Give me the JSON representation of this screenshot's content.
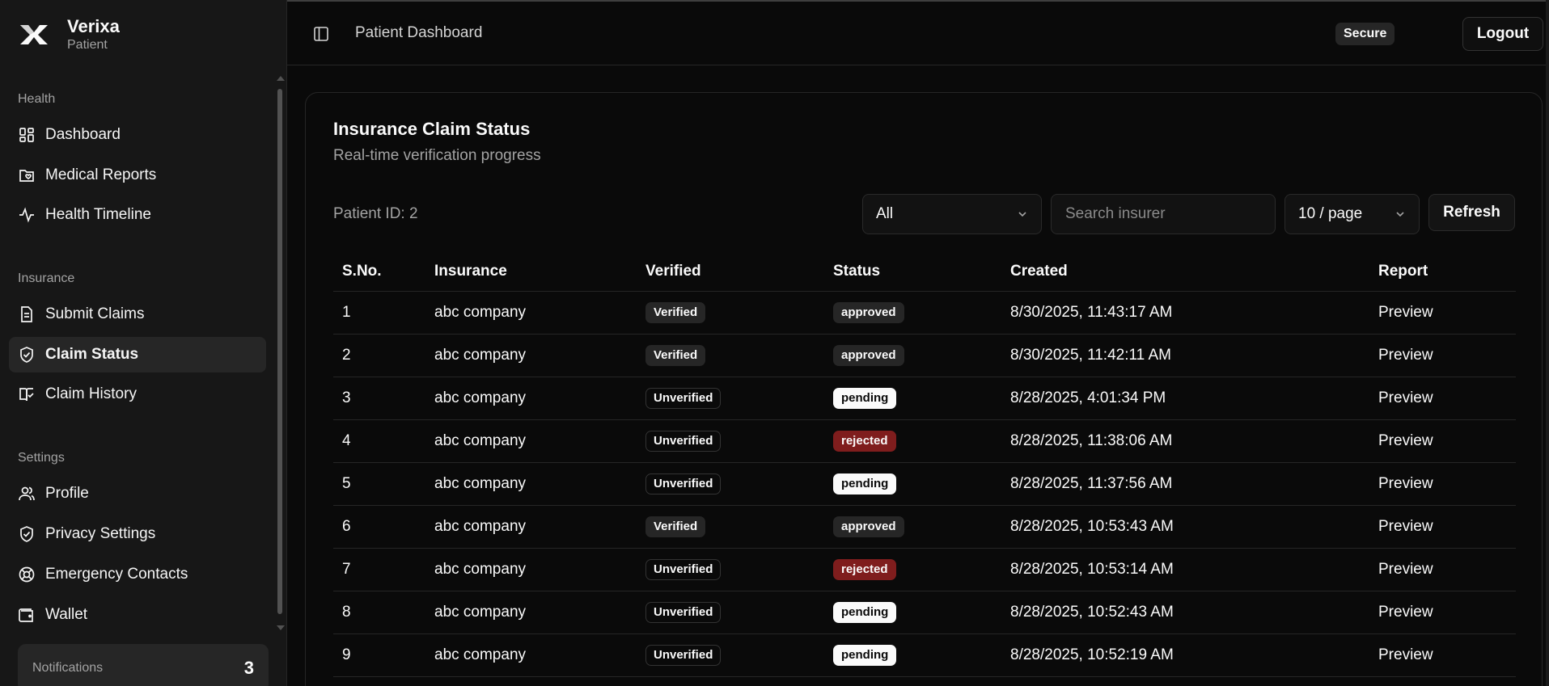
{
  "brand": {
    "name": "Verixa",
    "role": "Patient",
    "icon": "verixa-logo-icon"
  },
  "sidebar": {
    "sections": [
      {
        "label": "Health",
        "items": [
          {
            "label": "Dashboard",
            "icon": "dashboard-icon"
          },
          {
            "label": "Medical Reports",
            "icon": "folder-heart-icon"
          },
          {
            "label": "Health Timeline",
            "icon": "activity-icon"
          }
        ]
      },
      {
        "label": "Insurance",
        "items": [
          {
            "label": "Submit Claims",
            "icon": "file-text-icon"
          },
          {
            "label": "Claim Status",
            "icon": "shield-check-icon",
            "active": true
          },
          {
            "label": "Claim History",
            "icon": "book-check-icon"
          }
        ]
      },
      {
        "label": "Settings",
        "items": [
          {
            "label": "Profile",
            "icon": "users-icon"
          },
          {
            "label": "Privacy Settings",
            "icon": "shield-icon"
          },
          {
            "label": "Emergency Contacts",
            "icon": "life-buoy-icon"
          },
          {
            "label": "Wallet",
            "icon": "wallet-icon"
          }
        ]
      }
    ],
    "notifications": {
      "label": "Notifications",
      "count": "3"
    }
  },
  "header": {
    "title": "Patient Dashboard",
    "secure_badge": "Secure",
    "logout_label": "Logout"
  },
  "card": {
    "title": "Insurance Claim Status",
    "subtitle": "Real-time verification progress",
    "patient_id": "Patient ID: 2",
    "filter": {
      "selected": "All"
    },
    "search": {
      "placeholder": "Search insurer",
      "value": ""
    },
    "page_size": {
      "selected": "10 / page"
    },
    "refresh_label": "Refresh"
  },
  "table": {
    "columns": [
      "S.No.",
      "Insurance",
      "Verified",
      "Status",
      "Created",
      "Report"
    ],
    "rows": [
      {
        "sno": "1",
        "insurance": "abc company",
        "verified": "Verified",
        "status": "approved",
        "created": "8/30/2025, 11:43:17 AM",
        "report": "Preview"
      },
      {
        "sno": "2",
        "insurance": "abc company",
        "verified": "Verified",
        "status": "approved",
        "created": "8/30/2025, 11:42:11 AM",
        "report": "Preview"
      },
      {
        "sno": "3",
        "insurance": "abc company",
        "verified": "Unverified",
        "status": "pending",
        "created": "8/28/2025, 4:01:34 PM",
        "report": "Preview"
      },
      {
        "sno": "4",
        "insurance": "abc company",
        "verified": "Unverified",
        "status": "rejected",
        "created": "8/28/2025, 11:38:06 AM",
        "report": "Preview"
      },
      {
        "sno": "5",
        "insurance": "abc company",
        "verified": "Unverified",
        "status": "pending",
        "created": "8/28/2025, 11:37:56 AM",
        "report": "Preview"
      },
      {
        "sno": "6",
        "insurance": "abc company",
        "verified": "Verified",
        "status": "approved",
        "created": "8/28/2025, 10:53:43 AM",
        "report": "Preview"
      },
      {
        "sno": "7",
        "insurance": "abc company",
        "verified": "Unverified",
        "status": "rejected",
        "created": "8/28/2025, 10:53:14 AM",
        "report": "Preview"
      },
      {
        "sno": "8",
        "insurance": "abc company",
        "verified": "Unverified",
        "status": "pending",
        "created": "8/28/2025, 10:52:43 AM",
        "report": "Preview"
      },
      {
        "sno": "9",
        "insurance": "abc company",
        "verified": "Unverified",
        "status": "pending",
        "created": "8/28/2025, 10:52:19 AM",
        "report": "Preview"
      }
    ]
  }
}
